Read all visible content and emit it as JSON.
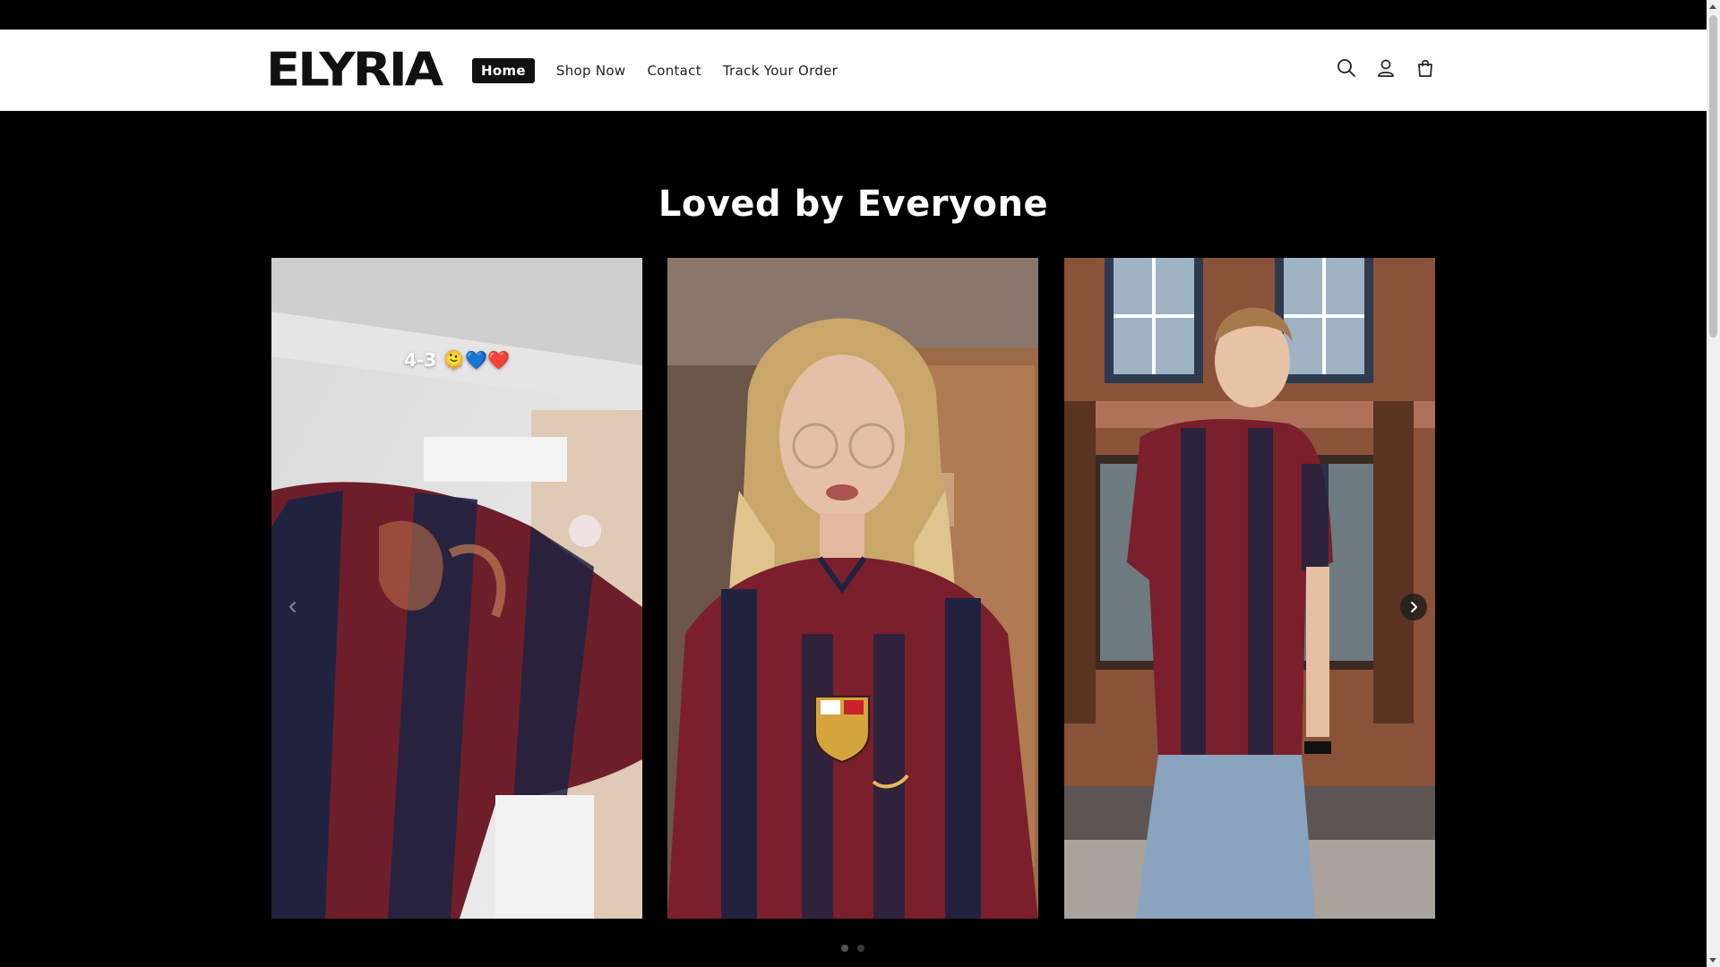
{
  "brand": {
    "logo_text": "ELYRIA"
  },
  "nav": {
    "items": [
      {
        "label": "Home",
        "active": true
      },
      {
        "label": "Shop Now",
        "active": false
      },
      {
        "label": "Contact",
        "active": false
      },
      {
        "label": "Track Your Order",
        "active": false
      }
    ]
  },
  "header_icons": [
    "search-icon",
    "account-icon",
    "cart-icon"
  ],
  "section": {
    "title": "Loved by Everyone"
  },
  "slides": [
    {
      "caption": "4-3 🫠💙❤️",
      "subject": "person holding maroon and navy striped football shirt"
    },
    {
      "caption": "",
      "subject": "woman with glasses wearing maroon and navy striped football jersey"
    },
    {
      "caption": "",
      "subject": "young man in maroon and navy jersey and jeans on street in front of brick building"
    }
  ],
  "carousel": {
    "dots": 2,
    "active_dot": 0
  },
  "colors": {
    "background": "#000000",
    "header": "#ffffff",
    "jersey_maroon": "#7a1f2b",
    "jersey_navy": "#1f2340"
  }
}
